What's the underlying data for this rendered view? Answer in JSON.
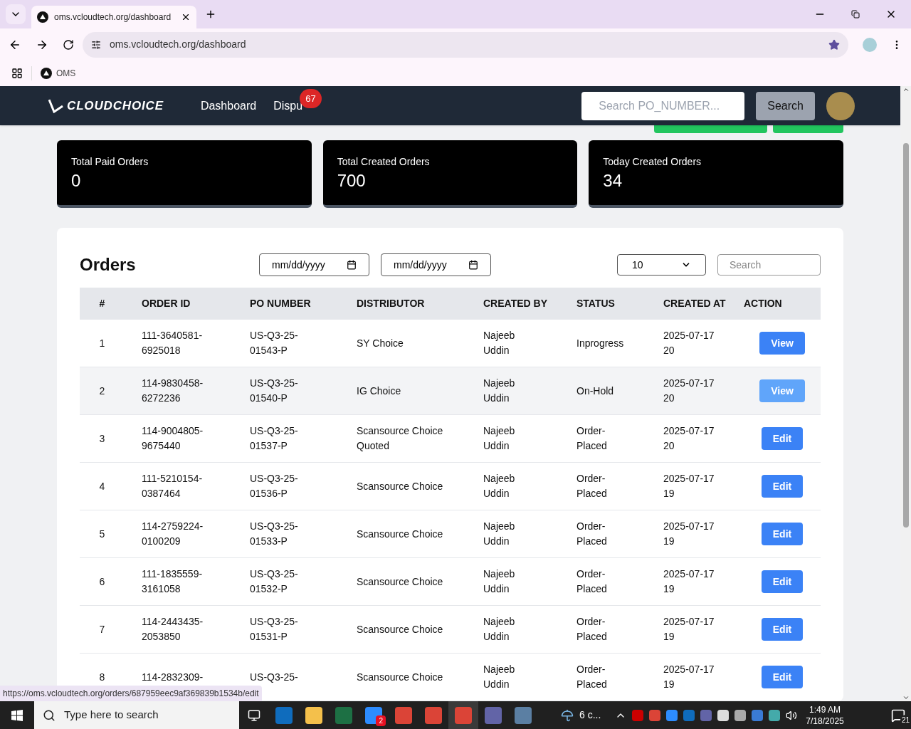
{
  "browser": {
    "tab_title": "oms.vcloudtech.org/dashboard",
    "url": "oms.vcloudtech.org/dashboard",
    "bookmarks": [
      "OMS"
    ],
    "status_url": "https://oms.vcloudtech.org/orders/687959eec9af369839b1534b/edit"
  },
  "navbar": {
    "logo": "CLOUDCHOICE",
    "links": [
      {
        "label": "Dashboard"
      },
      {
        "label": "Dispu",
        "badge": "67"
      }
    ],
    "search": {
      "placeholder": "Search PO_NUMBER..."
    },
    "search_button": "Search"
  },
  "stats": [
    {
      "label": "Total Paid Orders",
      "value": "0"
    },
    {
      "label": "Total Created Orders",
      "value": "700"
    },
    {
      "label": "Today Created Orders",
      "value": "34"
    }
  ],
  "orders": {
    "title": "Orders",
    "date_from": {
      "placeholder": "mm/dd/yyyy"
    },
    "date_to": {
      "placeholder": "mm/dd/yyyy"
    },
    "page_size": "10",
    "search": {
      "placeholder": "Search"
    },
    "columns": [
      "#",
      "ORDER ID",
      "PO NUMBER",
      "DISTRIBUTOR",
      "CREATED BY",
      "STATUS",
      "CREATED AT",
      "ACTION"
    ],
    "rows": [
      {
        "num": "1",
        "order_id": "111-3640581-6925018",
        "po_number": "US-Q3-25-01543-P",
        "distributor": "SY Choice",
        "created_by": "Najeeb Uddin",
        "status": "Inprogress",
        "created_at": "2025-07-17 20",
        "action": "View",
        "hovered": false
      },
      {
        "num": "2",
        "order_id": "114-9830458-6272236",
        "po_number": "US-Q3-25-01540-P",
        "distributor": "IG Choice",
        "created_by": "Najeeb Uddin",
        "status": "On-Hold",
        "created_at": "2025-07-17 20",
        "action": "View",
        "hovered": true
      },
      {
        "num": "3",
        "order_id": "114-9004805-9675440",
        "po_number": "US-Q3-25-01537-P",
        "distributor": "Scansource Choice Quoted",
        "created_by": "Najeeb Uddin",
        "status": "Order-Placed",
        "created_at": "2025-07-17 20",
        "action": "Edit",
        "hovered": false
      },
      {
        "num": "4",
        "order_id": "111-5210154-0387464",
        "po_number": "US-Q3-25-01536-P",
        "distributor": "Scansource Choice",
        "created_by": "Najeeb Uddin",
        "status": "Order-Placed",
        "created_at": "2025-07-17 19",
        "action": "Edit",
        "hovered": false
      },
      {
        "num": "5",
        "order_id": "114-2759224-0100209",
        "po_number": "US-Q3-25-01533-P",
        "distributor": "Scansource Choice",
        "created_by": "Najeeb Uddin",
        "status": "Order-Placed",
        "created_at": "2025-07-17 19",
        "action": "Edit",
        "hovered": false
      },
      {
        "num": "6",
        "order_id": "111-1835559-3161058",
        "po_number": "US-Q3-25-01532-P",
        "distributor": "Scansource Choice",
        "created_by": "Najeeb Uddin",
        "status": "Order-Placed",
        "created_at": "2025-07-17 19",
        "action": "Edit",
        "hovered": false
      },
      {
        "num": "7",
        "order_id": "114-2443435-2053850",
        "po_number": "US-Q3-25-01531-P",
        "distributor": "Scansource Choice",
        "created_by": "Najeeb Uddin",
        "status": "Order-Placed",
        "created_at": "2025-07-17 19",
        "action": "Edit",
        "hovered": false
      },
      {
        "num": "8",
        "order_id": "114-2832309-",
        "po_number": "US-Q3-25-",
        "distributor": "Scansource Choice",
        "created_by": "Najeeb Uddin",
        "status": "Order-Placed",
        "created_at": "2025-07-17 19",
        "action": "Edit",
        "hovered": false
      }
    ]
  },
  "taskbar": {
    "search": {
      "placeholder": "Type here to search"
    },
    "zoom_badge": "2",
    "weather": "6 c...",
    "time": "1:49 AM",
    "date": "7/18/2025",
    "notifications": "21"
  }
}
